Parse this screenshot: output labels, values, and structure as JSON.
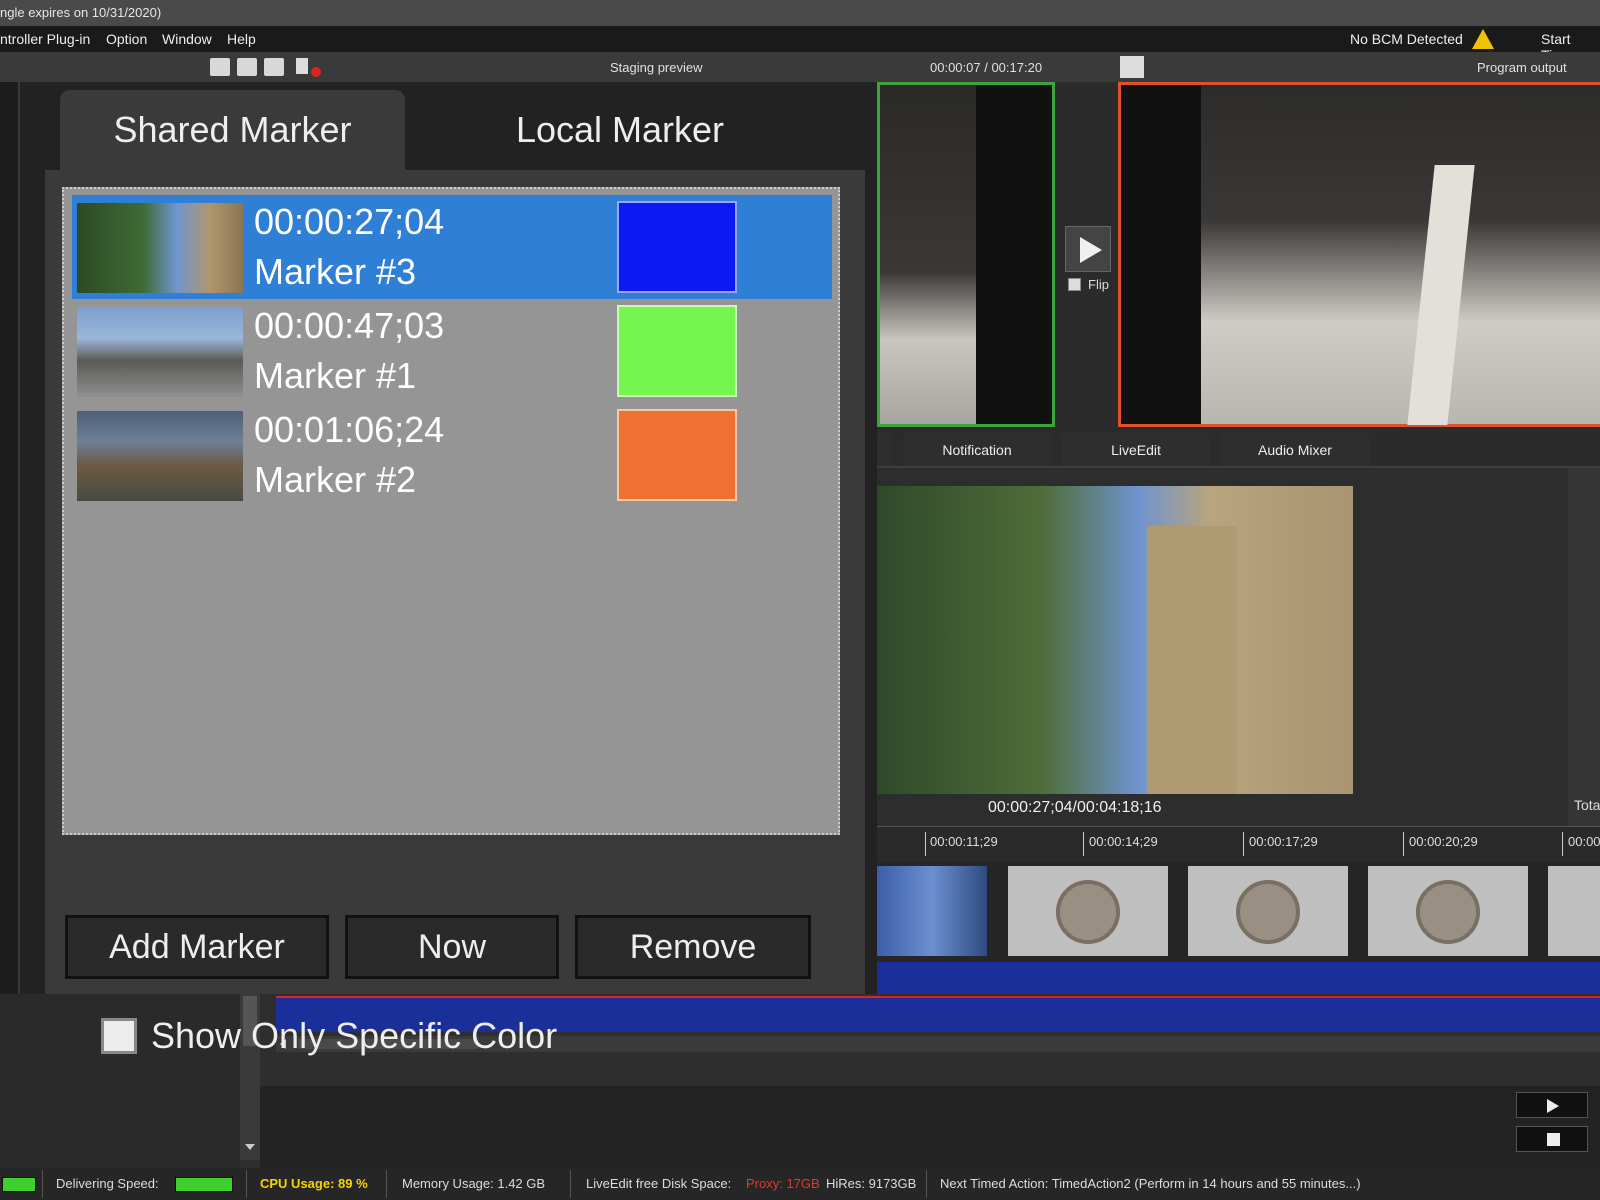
{
  "titlebar": {
    "text": "ngle expires on 10/31/2020)"
  },
  "menu": {
    "items": [
      "ntroller Plug-in",
      "Option",
      "Window",
      "Help"
    ],
    "bcm_status": "No BCM Detected",
    "start_time": "Start Time"
  },
  "toolbar": {
    "staging_title": "Staging preview",
    "staging_time": "00:00:07 / 00:17:20",
    "program_title": "Program output"
  },
  "marker_dialog": {
    "tabs": [
      "Shared Marker",
      "Local Marker"
    ],
    "markers": [
      {
        "time": "00:00:27;04",
        "name": "Marker #3",
        "color": "#0a1af0",
        "selected": true
      },
      {
        "time": "00:00:47;03",
        "name": "Marker #1",
        "color": "#76f54e",
        "selected": false
      },
      {
        "time": "00:01:06;24",
        "name": "Marker #2",
        "color": "#ef7030",
        "selected": false
      }
    ],
    "buttons": {
      "add": "Add Marker",
      "now": "Now",
      "remove": "Remove"
    },
    "checkbox_label": "Show Only Specific Color"
  },
  "flip_label": "Flip",
  "panel_tabs": {
    "notification": "Notification",
    "liveedit": "LiveEdit",
    "audio_mixer": "Audio Mixer"
  },
  "playback": {
    "timecode": "00:00:27;04/00:04:18;16",
    "total_label": "Tota"
  },
  "ruler": [
    "00:00:11;29",
    "00:00:14;29",
    "00:00:17;29",
    "00:00:20;29",
    "00:00"
  ],
  "statusbar": {
    "delivering_label": "Delivering Speed:",
    "cpu": "CPU Usage:  89 %",
    "memory": "Memory Usage: 1.42 GB",
    "disk_label": "LiveEdit free Disk Space:",
    "proxy": "Proxy: 17GB",
    "hires": "HiRes: 9173GB",
    "next_action": "Next Timed Action:  TimedAction2 (Perform in 14 hours and 55 minutes...)"
  },
  "colors": {
    "accent_blue": "#2f7fd6",
    "staging_border": "#3da33d",
    "program_border": "#e0502a",
    "timeline_blue": "#1b2f9a",
    "cpu_yellow": "#f5d300"
  }
}
